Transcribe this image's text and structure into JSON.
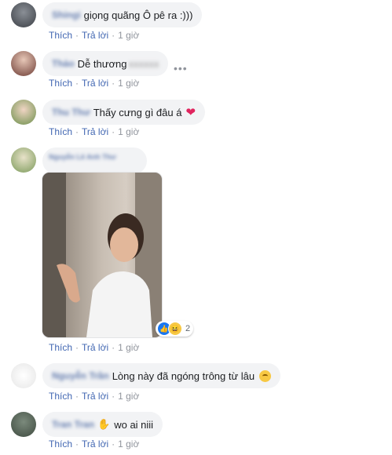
{
  "actions": {
    "like": "Thích",
    "reply": "Trả lời",
    "dot": "·"
  },
  "comments": [
    {
      "name": "Shingi",
      "text": "giọng quãng Ô pê ra :)))",
      "time": "1 giờ"
    },
    {
      "name": "Thảo",
      "text": "Dễ thương",
      "time": "1 giờ",
      "more_icon": "ellipsis-icon"
    },
    {
      "name": "Thu Thư",
      "text": "Thấy cưng gì đâu á",
      "emoji": "heart-icon",
      "time": "1 giờ"
    },
    {
      "name": "Nguyễn Lê Anh Thư",
      "media": "photo-attachment",
      "reactions": {
        "types": [
          "like-icon",
          "haha-icon"
        ],
        "count": "2"
      },
      "time": "1 giờ"
    },
    {
      "name": "Nguyễn Trần",
      "text": "Lòng này đã ngóng trông từ lâu",
      "emoji": "smirk-emoji-icon",
      "time": "1 giờ"
    },
    {
      "name": "Tran Tran",
      "text": "wo ai niii",
      "emoji": "waving-hand-icon",
      "time": "1 giờ"
    }
  ]
}
